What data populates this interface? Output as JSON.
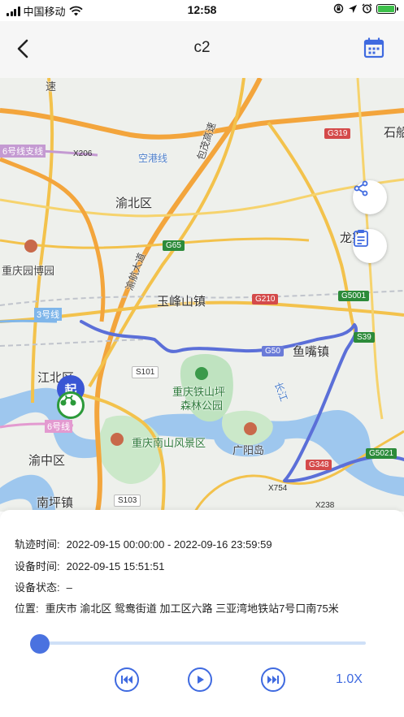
{
  "status_bar": {
    "carrier": "中国移动",
    "time": "12:58"
  },
  "nav": {
    "title": "c2"
  },
  "map": {
    "labels": {
      "yubei": "渝北区",
      "yufeng": "玉峰山镇",
      "jiangbei": "江北区",
      "yuzhong": "渝中区",
      "nanping": "南坪镇",
      "yuzui": "鱼嘴镇",
      "tieshanping": "重庆铁山坪",
      "senlin": "森林公园",
      "nanshan": "重庆南山风景区",
      "guangyang": "广阳岛",
      "yuanbo": "重庆园博园",
      "konggang": "空港线",
      "line3": "3号线",
      "line6": "6号线",
      "line6b": "6号线支线",
      "baomao": "包茂高速",
      "yuhang": "渝航大道",
      "longxing": "龙兴",
      "shi": "石船",
      "su": "速",
      "changjiang": "长江"
    },
    "shields": {
      "g319": "G319",
      "g65": "G65",
      "g210": "G210",
      "g5001": "G5001",
      "s39": "S39",
      "s101": "S101",
      "s103": "S103",
      "g348": "G348",
      "x206": "X206",
      "x754": "X754",
      "x238": "X238",
      "g5021": "G5021",
      "g50": "G50"
    },
    "start_marker": "起"
  },
  "info": {
    "track_time_label": "轨迹时间:",
    "track_time_value": "2022-09-15 00:00:00 - 2022-09-16 23:59:59",
    "device_time_label": "设备时间:",
    "device_time_value": "2022-09-15 15:51:51",
    "device_status_label": "设备状态:",
    "device_status_value": "–",
    "location_label": "位置:",
    "location_value": "重庆市 渝北区 鸳鸯街道 加工区六路 三亚湾地铁站7号口南75米"
  },
  "playback": {
    "progress_fraction": 0.0,
    "speed_label": "1.0X"
  },
  "colors": {
    "accent": "#3f6ae0",
    "track": "#5b6fd8",
    "vehicle": "#2c9a3a"
  }
}
